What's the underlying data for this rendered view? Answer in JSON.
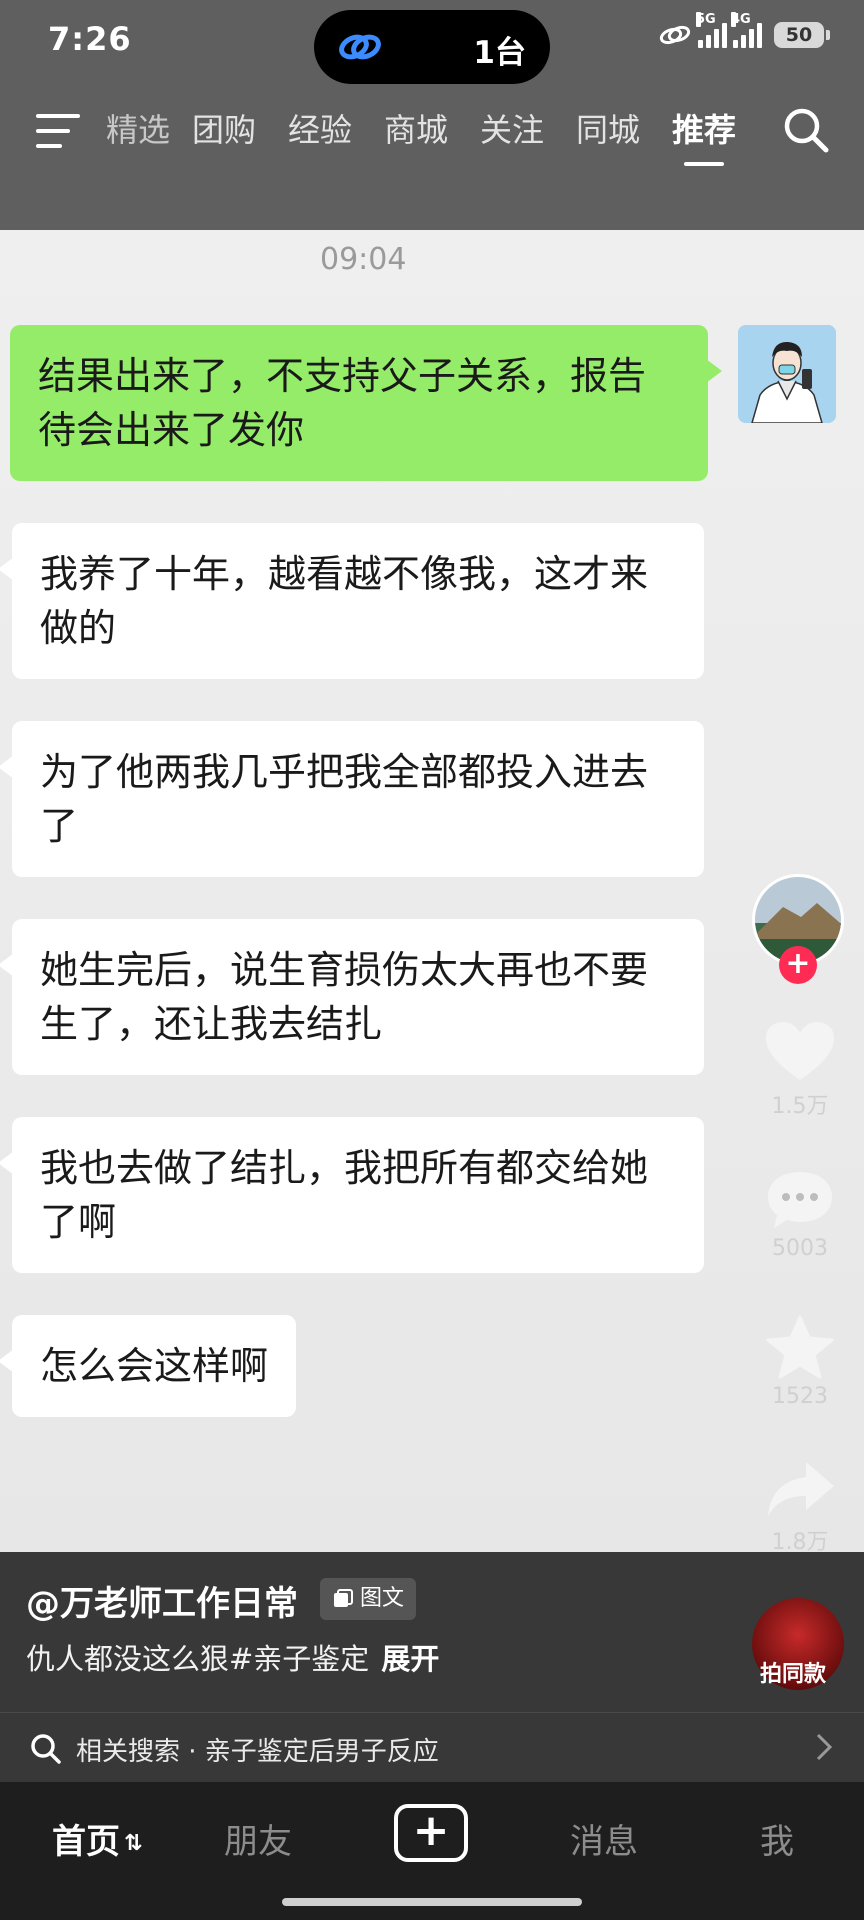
{
  "status_bar": {
    "time": "7:26",
    "island_text": "1台",
    "network_1": "5G",
    "network_2": "4G",
    "battery": "50"
  },
  "top_nav": {
    "tabs": [
      "精选",
      "团购",
      "经验",
      "商城",
      "关注",
      "同城",
      "推荐"
    ],
    "active_tab": "推荐"
  },
  "chat": {
    "timestamp": "09:04",
    "messages": [
      {
        "side": "mine",
        "text": "结果出来了，不支持父子关系，报告待会出来了发你"
      },
      {
        "side": "theirs",
        "text": "我养了十年，越看越不像我，这才来做的"
      },
      {
        "side": "theirs",
        "text": "为了他两我几乎把我全部都投入进去了"
      },
      {
        "side": "theirs",
        "text": "她生完后，说生育损伤太大再也不要生了，还让我去结扎"
      },
      {
        "side": "theirs",
        "text": "我也去做了结扎，我把所有都交给她了啊"
      },
      {
        "side": "theirs",
        "text": "怎么会这样啊"
      }
    ]
  },
  "actions": {
    "like_count": "1.5万",
    "comment_count": "5003",
    "favorite_count": "1523",
    "share_count": "1.8万",
    "follow_symbol": "+"
  },
  "info": {
    "author": "@万老师工作日常",
    "tag": "图文",
    "caption": "仇人都没这么狠#亲子鉴定",
    "expand": "展开",
    "disc_label": "拍同款",
    "related_search": "相关搜索 · 亲子鉴定后男子反应"
  },
  "bottom_nav": {
    "home": "首页",
    "friends": "朋友",
    "plus": "+",
    "messages": "消息",
    "me": "我"
  },
  "colors": {
    "my_bubble": "#95ec69",
    "their_bubble": "#ffffff",
    "follow_accent": "#fe2c55"
  }
}
